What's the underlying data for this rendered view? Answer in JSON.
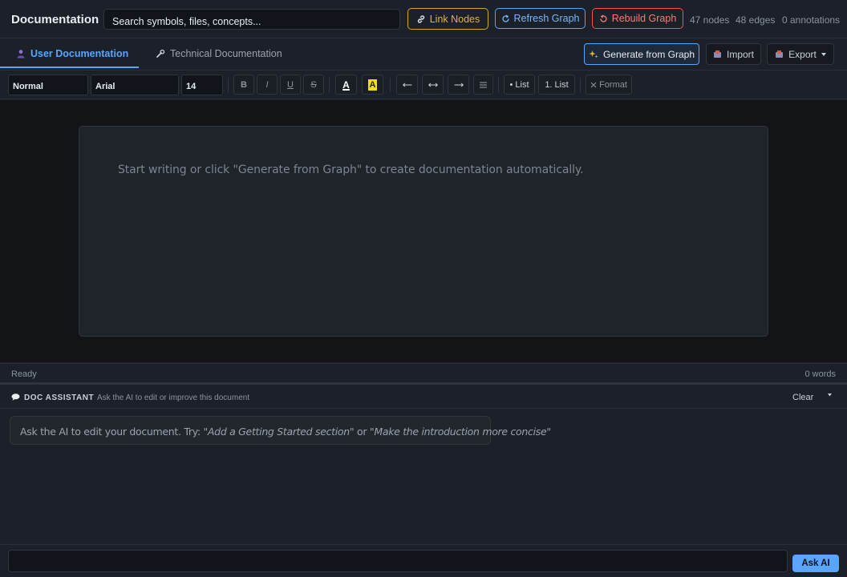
{
  "header": {
    "title": "Documentation",
    "search_placeholder": "Search symbols, files, concepts...",
    "link_nodes": "Link Nodes",
    "refresh_graph": "Refresh Graph",
    "rebuild_graph": "Rebuild Graph",
    "nodes": "47 nodes",
    "edges": "48 edges",
    "annotations": "0 annotations"
  },
  "tabs": {
    "user": "User Documentation",
    "technical": "Technical Documentation",
    "active": "user"
  },
  "actions": {
    "generate": "Generate from Graph",
    "import": "Import",
    "export": "Export"
  },
  "toolbar": {
    "style": "Normal",
    "font": "Arial",
    "size": "14",
    "bold": "B",
    "italic": "I",
    "underline": "U",
    "strike": "S",
    "text_color": "A",
    "highlight": "A",
    "bullet_list": "• List",
    "numbered_list": "1. List",
    "clear_format": "Format"
  },
  "editor": {
    "placeholder": "Start writing or click \"Generate from Graph\" to create documentation automatically."
  },
  "status": {
    "left": "Ready",
    "right": "0 words"
  },
  "assistant": {
    "title": "DOC ASSISTANT",
    "subtitle": "Ask the AI to edit or improve this document",
    "clear": "Clear",
    "hint_prefix": "Ask the AI to edit your document. Try: ",
    "hint_example1": "\"Add a Getting Started section\"",
    "hint_mid": " or ",
    "hint_example2": "\"Make the introduction more concise\"",
    "ask_button": "Ask AI",
    "input_value": ""
  },
  "colors": {
    "accent": "#58a6ff",
    "link_nodes": "#e3b341",
    "rebuild": "#ff7b72",
    "highlight": "#f2e100"
  }
}
